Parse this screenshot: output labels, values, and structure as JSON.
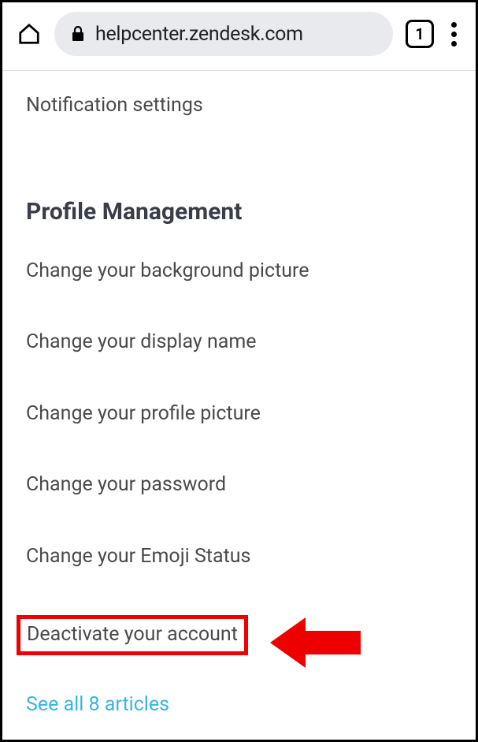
{
  "browser": {
    "url": "helpcenter.zendesk.com",
    "tab_count": "1"
  },
  "first_link": "Notification settings",
  "section_title": "Profile Management",
  "links": {
    "0": "Change your background picture",
    "1": "Change your display name",
    "2": "Change your profile picture",
    "3": "Change your password",
    "4": "Change your Emoji Status",
    "5": "Deactivate your account"
  },
  "see_all": "See all 8 articles"
}
